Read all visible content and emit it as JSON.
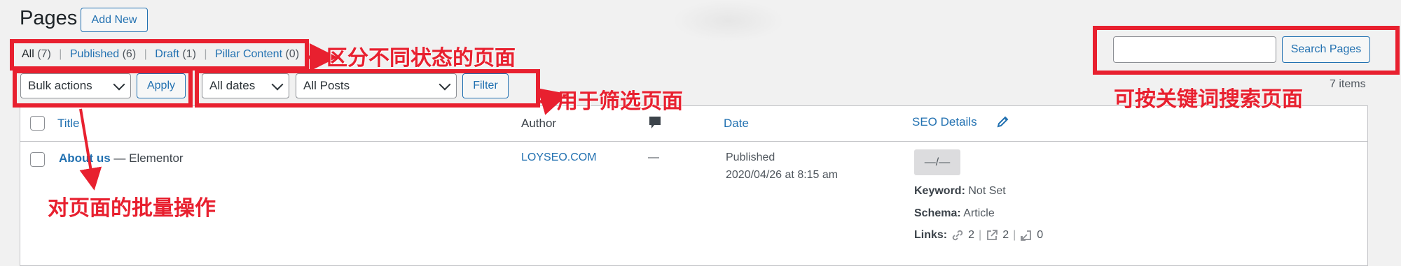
{
  "header": {
    "title": "Pages",
    "add_new": "Add New"
  },
  "views": {
    "all_label": "All",
    "all_count": "(7)",
    "published_label": "Published",
    "published_count": "(6)",
    "draft_label": "Draft",
    "draft_count": "(1)",
    "pillar_label": "Pillar Content",
    "pillar_count": "(0)",
    "separator": "|"
  },
  "bulk": {
    "selected": "Bulk actions",
    "apply": "Apply"
  },
  "filters": {
    "dates": "All dates",
    "posts": "All Posts",
    "filter": "Filter"
  },
  "search": {
    "value": "",
    "button": "Search Pages"
  },
  "items_count": "7 items",
  "columns": {
    "title": "Title",
    "author": "Author",
    "comments_icon": "comment-bubble-icon",
    "date": "Date",
    "seo": "SEO Details",
    "seo_edit_icon": "pencil-icon"
  },
  "rows": [
    {
      "title": "About us",
      "state": "— Elementor",
      "author": "LOYSEO.COM",
      "comments": "—",
      "date_status": "Published",
      "date_value": "2020/04/26 at 8:15 am",
      "seo_score": "—/—",
      "keyword_label": "Keyword:",
      "keyword_value": "Not Set",
      "schema_label": "Schema:",
      "schema_value": "Article",
      "links_label": "Links:",
      "links_internal": "2",
      "links_external": "2",
      "links_incoming": "0",
      "links_sep": "|"
    }
  ],
  "annotations": {
    "status": "区分不同状态的页面",
    "filter": "用于筛选页面",
    "search": "可按关键词搜索页面",
    "bulk": "对页面的批量操作",
    "color": "#e8202f"
  }
}
